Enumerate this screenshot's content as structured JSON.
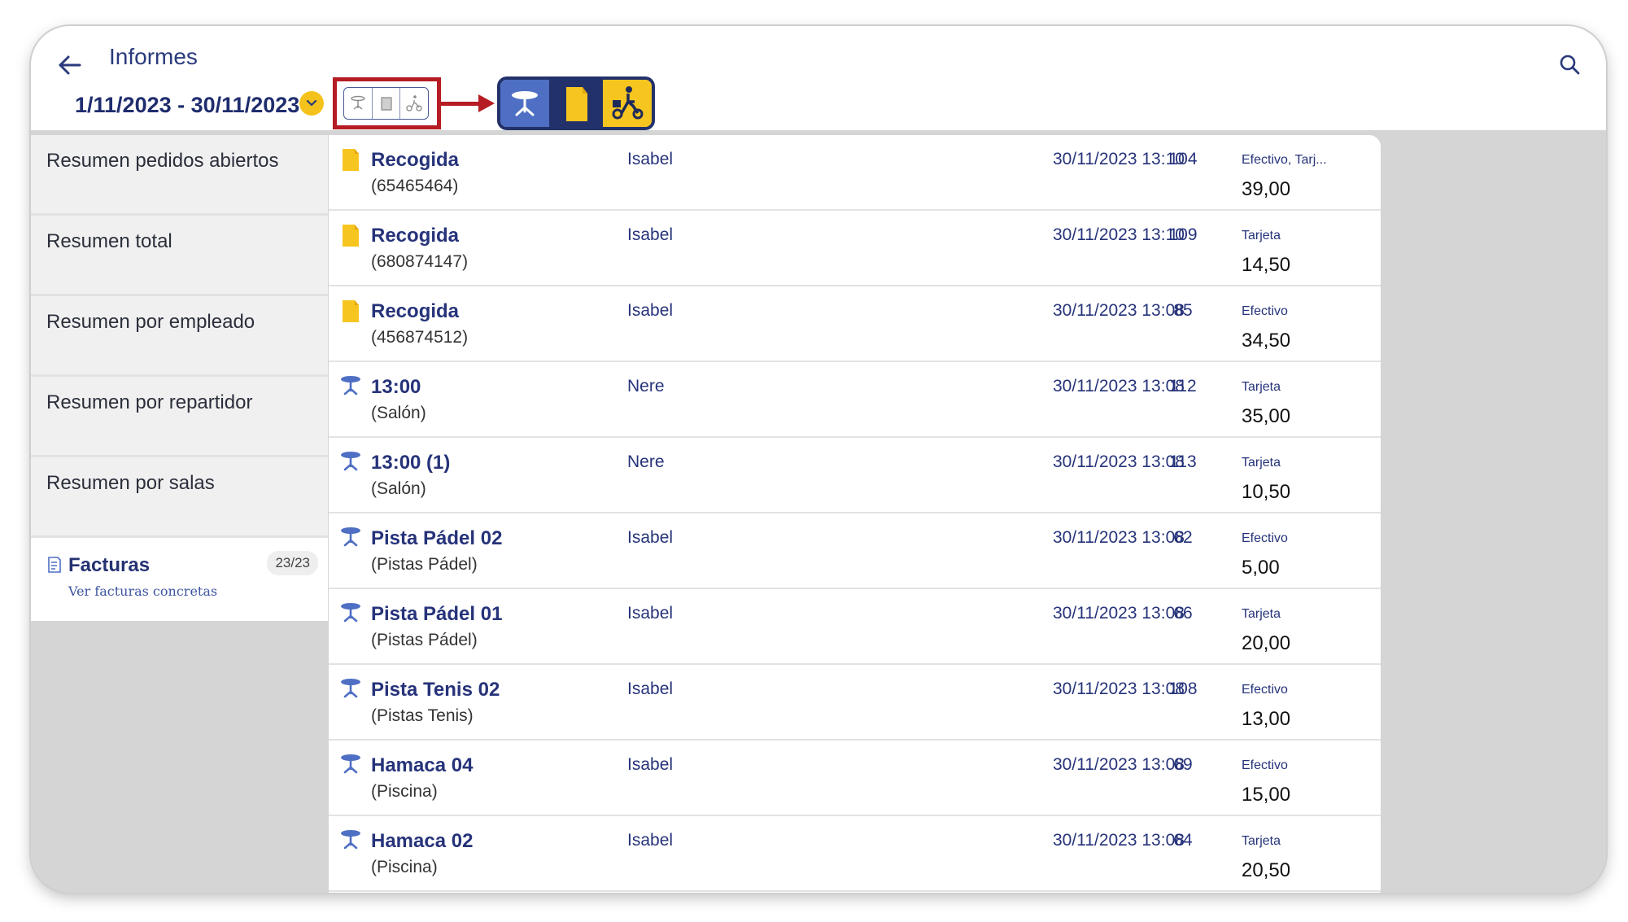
{
  "header": {
    "title": "Informes",
    "date_range": "1/11/2023 - 30/11/2023"
  },
  "filter_mini": {
    "icons": [
      "table-icon",
      "bag-icon",
      "scooter-icon"
    ]
  },
  "filter_large": {
    "segments": [
      {
        "icon": "table-icon",
        "color": "#4e6fc4"
      },
      {
        "icon": "bag-icon",
        "color": "#23316a"
      },
      {
        "icon": "scooter-icon",
        "color": "#f7c51f"
      }
    ]
  },
  "sidebar": {
    "items": [
      {
        "label": "Resumen pedidos abiertos"
      },
      {
        "label": "Resumen total"
      },
      {
        "label": "Resumen por empleado"
      },
      {
        "label": "Resumen por repartidor"
      },
      {
        "label": "Resumen por salas"
      }
    ],
    "facturas": {
      "title": "Facturas",
      "subtitle": "Ver facturas concretas",
      "badge": "23/23"
    }
  },
  "rows": [
    {
      "type": "bag",
      "name": "Recogida",
      "sub": "(65465464)",
      "employee": "Isabel",
      "datetime": "30/11/2023 13:10",
      "num": "104",
      "payment": "Efectivo, Tarj...",
      "total": "39,00"
    },
    {
      "type": "bag",
      "name": "Recogida",
      "sub": "(680874147)",
      "employee": "Isabel",
      "datetime": "30/11/2023 13:10",
      "num": "109",
      "payment": "Tarjeta",
      "total": "14,50"
    },
    {
      "type": "bag",
      "name": "Recogida",
      "sub": "(456874512)",
      "employee": "Isabel",
      "datetime": "30/11/2023 13:08",
      "num": "85",
      "payment": "Efectivo",
      "total": "34,50"
    },
    {
      "type": "table",
      "name": "13:00",
      "sub": "(Salón)",
      "employee": "Nere",
      "datetime": "30/11/2023 13:08",
      "num": "112",
      "payment": "Tarjeta",
      "total": "35,00"
    },
    {
      "type": "table",
      "name": "13:00 (1)",
      "sub": "(Salón)",
      "employee": "Nere",
      "datetime": "30/11/2023 13:08",
      "num": "113",
      "payment": "Tarjeta",
      "total": "10,50"
    },
    {
      "type": "table",
      "name": "Pista Pádel 02",
      "sub": "(Pistas Pádel)",
      "employee": "Isabel",
      "datetime": "30/11/2023 13:08",
      "num": "62",
      "payment": "Efectivo",
      "total": "5,00"
    },
    {
      "type": "table",
      "name": "Pista Pádel 01",
      "sub": "(Pistas Pádel)",
      "employee": "Isabel",
      "datetime": "30/11/2023 13:08",
      "num": "66",
      "payment": "Tarjeta",
      "total": "20,00"
    },
    {
      "type": "table",
      "name": "Pista Tenis 02",
      "sub": "(Pistas Tenis)",
      "employee": "Isabel",
      "datetime": "30/11/2023 13:08",
      "num": "108",
      "payment": "Efectivo",
      "total": "13,00"
    },
    {
      "type": "table",
      "name": "Hamaca 04",
      "sub": "(Piscina)",
      "employee": "Isabel",
      "datetime": "30/11/2023 13:08",
      "num": "69",
      "payment": "Efectivo",
      "total": "15,00"
    },
    {
      "type": "table",
      "name": "Hamaca 02",
      "sub": "(Piscina)",
      "employee": "Isabel",
      "datetime": "30/11/2023 13:08",
      "num": "64",
      "payment": "Tarjeta",
      "total": "20,50"
    }
  ],
  "colors": {
    "accent": "#26337a",
    "highlight": "#b51c24",
    "yellow": "#f7c51f"
  }
}
